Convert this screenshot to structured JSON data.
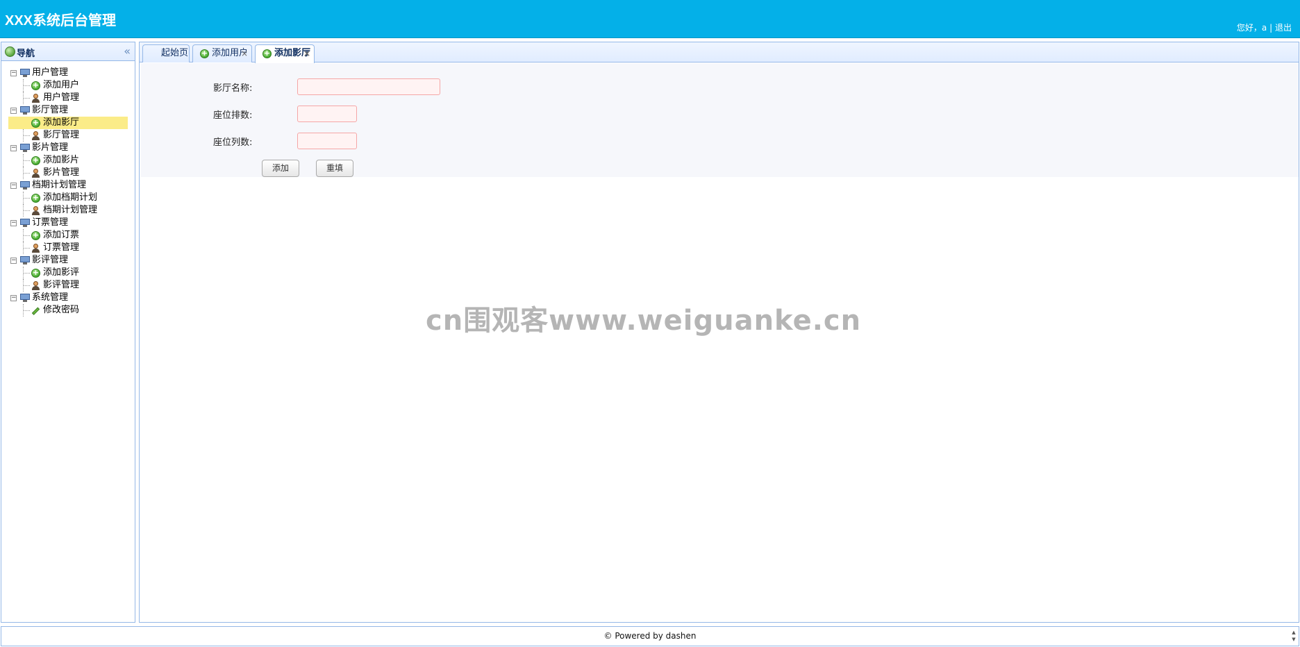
{
  "header": {
    "title": "XXX系统后台管理",
    "greeting": "您好，a",
    "separator": "|",
    "logout": "退出"
  },
  "nav": {
    "title": "导航",
    "collapse_icon": "«",
    "groups": [
      {
        "label": "用户管理",
        "items": [
          {
            "label": "添加用户",
            "icon": "add-icon"
          },
          {
            "label": "用户管理",
            "icon": "user-icon"
          }
        ]
      },
      {
        "label": "影厅管理",
        "items": [
          {
            "label": "添加影厅",
            "icon": "add-icon",
            "selected": true
          },
          {
            "label": "影厅管理",
            "icon": "user-icon"
          }
        ]
      },
      {
        "label": "影片管理",
        "items": [
          {
            "label": "添加影片",
            "icon": "add-icon"
          },
          {
            "label": "影片管理",
            "icon": "user-icon"
          }
        ]
      },
      {
        "label": "档期计划管理",
        "items": [
          {
            "label": "添加档期计划",
            "icon": "add-icon"
          },
          {
            "label": "档期计划管理",
            "icon": "user-icon"
          }
        ]
      },
      {
        "label": "订票管理",
        "items": [
          {
            "label": "添加订票",
            "icon": "add-icon"
          },
          {
            "label": "订票管理",
            "icon": "user-icon"
          }
        ]
      },
      {
        "label": "影评管理",
        "items": [
          {
            "label": "添加影评",
            "icon": "add-icon"
          },
          {
            "label": "影评管理",
            "icon": "user-icon"
          }
        ]
      },
      {
        "label": "系统管理",
        "items": [
          {
            "label": "修改密码",
            "icon": "pencil-icon"
          }
        ]
      }
    ]
  },
  "tabs": [
    {
      "label": "起始页",
      "closable": false,
      "active": false
    },
    {
      "label": "添加用户",
      "closable": true,
      "active": false
    },
    {
      "label": "添加影厅",
      "closable": true,
      "active": true
    }
  ],
  "tab_close_glyph": "×",
  "form": {
    "hall_name_label": "影厅名称:",
    "hall_name_value": "",
    "rows_label": "座位排数:",
    "rows_value": "",
    "cols_label": "座位列数:",
    "cols_value": "",
    "submit_label": "添加",
    "reset_label": "重填"
  },
  "watermark": "cn围观客www.weiguanke.cn",
  "footer": {
    "text": "© Powered by dashen"
  },
  "colors": {
    "header_bg": "#04b0e8",
    "panel_border": "#95b8e7",
    "selected_bg": "#fbec88",
    "input_border": "#f5a6a6"
  }
}
